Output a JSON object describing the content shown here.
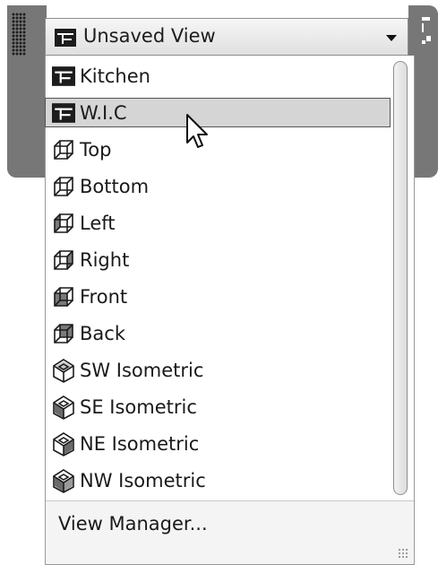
{
  "combo": {
    "current": "Unsaved View",
    "icon": "named-view-icon"
  },
  "items": [
    {
      "label": "Kitchen",
      "icon": "named-view-icon"
    },
    {
      "label": "W.I.C",
      "icon": "named-view-icon",
      "highlighted": true
    },
    {
      "label": "Top",
      "icon": "cube-top-icon"
    },
    {
      "label": "Bottom",
      "icon": "cube-bottom-icon"
    },
    {
      "label": "Left",
      "icon": "cube-left-icon"
    },
    {
      "label": "Right",
      "icon": "cube-right-icon"
    },
    {
      "label": "Front",
      "icon": "cube-front-icon"
    },
    {
      "label": "Back",
      "icon": "cube-back-icon"
    },
    {
      "label": "SW Isometric",
      "icon": "isometric-sw-icon"
    },
    {
      "label": "SE Isometric",
      "icon": "isometric-se-icon"
    },
    {
      "label": "NE Isometric",
      "icon": "isometric-ne-icon"
    },
    {
      "label": "NW Isometric",
      "icon": "isometric-nw-icon"
    }
  ],
  "footer": {
    "view_manager": "View Manager..."
  }
}
